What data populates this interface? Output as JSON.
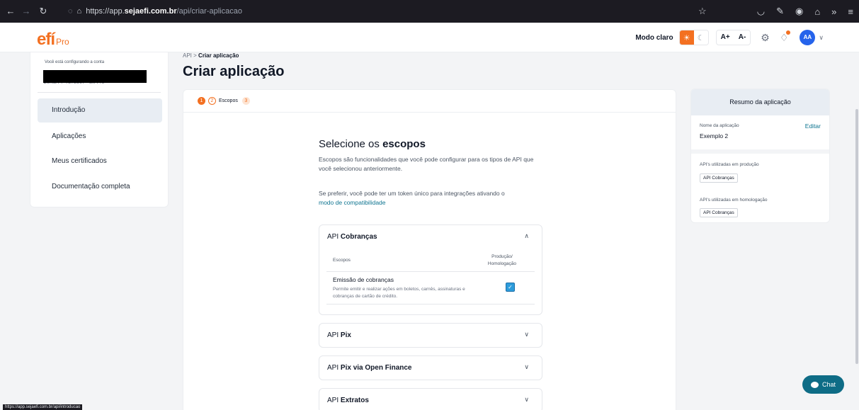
{
  "browser": {
    "url_prefix": "https://app.",
    "url_host": "sejaefi.com.br",
    "url_path": "/api/criar-aplicacao",
    "status_url": "https://app.sejaefi.com.br/api/introducao"
  },
  "header": {
    "logo_main": "efí",
    "logo_sub": "Pro",
    "mode_label": "Modo claro",
    "font_increase": "A+",
    "font_decrease": "A-",
    "avatar_initials": "AA"
  },
  "sidebar": {
    "account_label": "Você está configurando a conta",
    "account_line": "Conta PF 7272567 - EfI Pro",
    "items": [
      {
        "label": "Introdução"
      },
      {
        "label": "Aplicações"
      },
      {
        "label": "Meus certificados"
      },
      {
        "label": "Documentação completa"
      }
    ]
  },
  "breadcrumb": {
    "root": "API",
    "separator": ">",
    "current": "Criar aplicação"
  },
  "page_title": "Criar aplicação",
  "stepper": {
    "step1": "1",
    "step2": "2",
    "step2_label": "Escopos",
    "step3": "3"
  },
  "scopes_section": {
    "title_prefix": "Selecione os ",
    "title_bold": "escopos",
    "description": "Escopos são funcionalidades que você pode configurar para os tipos de API que você selecionou anteriormente.",
    "prefer_text": "Se preferir, você pode ter um token único para integrações ativando o",
    "compat_link": "modo de compatibilidade"
  },
  "api_panels": [
    {
      "prefix": "API ",
      "name": "Cobranças",
      "expanded": true,
      "col_scopes": "Escopos",
      "col_prod_1": "Produção/",
      "col_prod_2": "Homologação",
      "scope_name": "Emissão de cobranças",
      "scope_desc": "Permite emitir e realizar ações em boletos, carnês, assinaturas e cobranças de cartão de crédito."
    },
    {
      "prefix": "API ",
      "name": "Pix",
      "expanded": false
    },
    {
      "prefix": "API ",
      "name": "Pix via Open Finance",
      "expanded": false
    },
    {
      "prefix": "API ",
      "name": "Extratos",
      "expanded": false
    }
  ],
  "summary": {
    "title": "Resumo da aplicação",
    "name_label": "Nome da aplicação",
    "edit_label": "Editar",
    "app_name": "Exemplo 2",
    "prod_label": "API's utilizadas em produção",
    "prod_chip": "API Cobranças",
    "hom_label": "API's utilizadas em homologação",
    "hom_chip": "API Cobranças"
  },
  "chat": {
    "label": "Chat"
  },
  "colors": {
    "brand": "#f37021",
    "link": "#0e7490",
    "chat": "#0e6c86"
  }
}
